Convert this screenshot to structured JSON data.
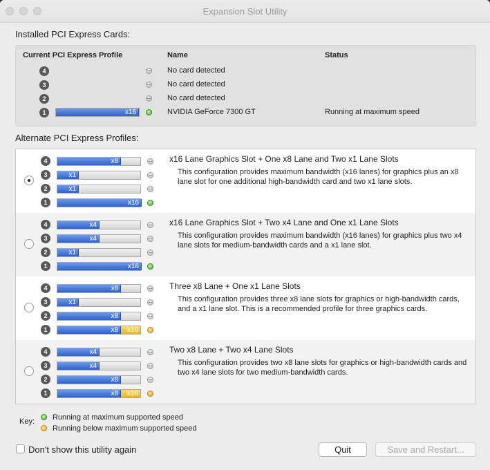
{
  "window": {
    "title": "Expansion Slot Utility"
  },
  "installed": {
    "section_label": "Installed PCI Express Cards:",
    "headers": {
      "profile": "Current PCI Express Profile",
      "name": "Name",
      "status": "Status"
    },
    "rows": [
      {
        "slot": "4",
        "name": "No card detected",
        "status": "",
        "led": "gray",
        "lane": ""
      },
      {
        "slot": "3",
        "name": "No card detected",
        "status": "",
        "led": "gray",
        "lane": ""
      },
      {
        "slot": "2",
        "name": "No card detected",
        "status": "",
        "led": "gray",
        "lane": ""
      },
      {
        "slot": "1",
        "name": "NVIDIA GeForce 7300 GT",
        "status": "Running at maximum speed",
        "led": "green",
        "lane": "x16"
      }
    ]
  },
  "alternate": {
    "section_label": "Alternate PCI Express Profiles:",
    "profiles": [
      {
        "title": "x16 Lane Graphics Slot + One x8 Lane and Two x1 Lane Slots",
        "description": "This configuration provides maximum bandwidth (x16 lanes) for graphics plus an x8 lane slot for one additional high-bandwidth card and two x1 lane slots.",
        "selected": true,
        "slots": [
          {
            "slot": "4",
            "lane": "x8",
            "fraction": 0.75,
            "extra": "",
            "led": "gray"
          },
          {
            "slot": "3",
            "lane": "x1",
            "fraction": 0.25,
            "extra": "",
            "led": "gray"
          },
          {
            "slot": "2",
            "lane": "x1",
            "fraction": 0.25,
            "extra": "",
            "led": "gray"
          },
          {
            "slot": "1",
            "lane": "x16",
            "fraction": 1.0,
            "extra": "",
            "led": "green"
          }
        ]
      },
      {
        "title": "x16 Lane Graphics Slot + Two x4 Lane and One x1 Lane Slots",
        "description": "This configuration provides maximum bandwidth (x16 lanes) for graphics plus two x4 lane slots for medium-bandwidth cards and a x1 lane slot.",
        "selected": false,
        "slots": [
          {
            "slot": "4",
            "lane": "x4",
            "fraction": 0.5,
            "extra": "",
            "led": "gray"
          },
          {
            "slot": "3",
            "lane": "x4",
            "fraction": 0.5,
            "extra": "",
            "led": "gray"
          },
          {
            "slot": "2",
            "lane": "x1",
            "fraction": 0.25,
            "extra": "",
            "led": "gray"
          },
          {
            "slot": "1",
            "lane": "x16",
            "fraction": 1.0,
            "extra": "",
            "led": "green"
          }
        ]
      },
      {
        "title": "Three x8 Lane + One x1 Lane Slots",
        "description": "This configuration provides three x8 lane slots for graphics or high-bandwidth cards, and a x1 lane slot.  This is a recommended profile for three graphics cards.",
        "selected": false,
        "slots": [
          {
            "slot": "4",
            "lane": "x8",
            "fraction": 0.75,
            "extra": "",
            "led": "gray"
          },
          {
            "slot": "3",
            "lane": "x1",
            "fraction": 0.25,
            "extra": "",
            "led": "gray"
          },
          {
            "slot": "2",
            "lane": "x8",
            "fraction": 0.75,
            "extra": "",
            "led": "gray"
          },
          {
            "slot": "1",
            "lane": "x8",
            "fraction": 0.75,
            "extra": "x16",
            "led": "orange"
          }
        ]
      },
      {
        "title": "Two x8 Lane + Two x4 Lane Slots",
        "description": "This configuration provides two x8 lane slots for graphics or high-bandwidth cards and two x4 lane slots for two medium-bandwidth cards.",
        "selected": false,
        "slots": [
          {
            "slot": "4",
            "lane": "x4",
            "fraction": 0.5,
            "extra": "",
            "led": "gray"
          },
          {
            "slot": "3",
            "lane": "x4",
            "fraction": 0.5,
            "extra": "",
            "led": "gray"
          },
          {
            "slot": "2",
            "lane": "x8",
            "fraction": 0.75,
            "extra": "",
            "led": "gray"
          },
          {
            "slot": "1",
            "lane": "x8",
            "fraction": 0.75,
            "extra": "x16",
            "led": "orange"
          }
        ]
      }
    ]
  },
  "key": {
    "label": "Key:",
    "items": [
      {
        "led": "green",
        "text": "Running at maximum supported speed"
      },
      {
        "led": "orange",
        "text": "Running below maximum supported speed"
      }
    ]
  },
  "footer": {
    "checkbox_label": "Don't show this utility again",
    "quit_label": "Quit",
    "save_label": "Save and Restart..."
  }
}
